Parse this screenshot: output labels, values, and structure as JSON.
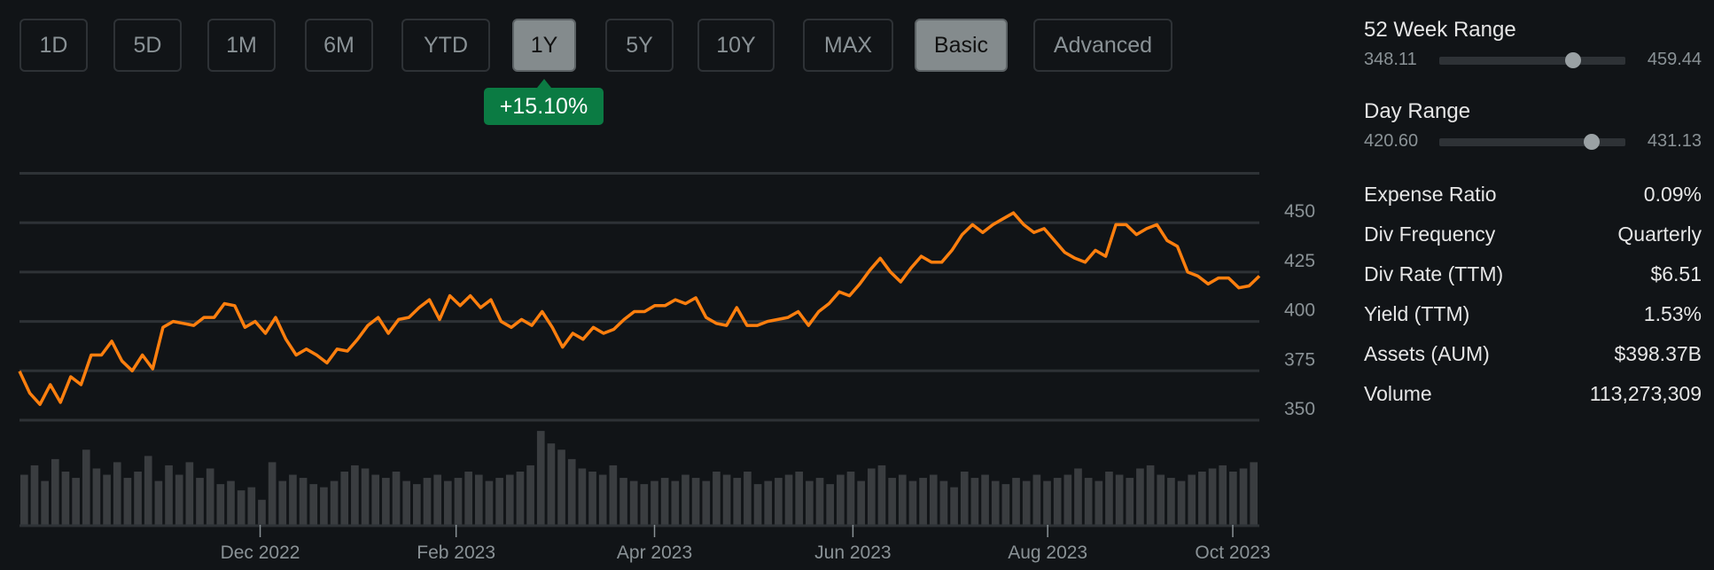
{
  "toolbar": {
    "ranges": [
      "1D",
      "5D",
      "1M",
      "6M",
      "YTD",
      "1Y",
      "5Y",
      "10Y",
      "MAX"
    ],
    "selected_range": "1Y",
    "modes": [
      "Basic",
      "Advanced"
    ],
    "selected_mode": "Basic",
    "change_badge": "+15.10%"
  },
  "colors": {
    "line": "#ff7f0e",
    "volume": "#3a3d40",
    "badge": "#0b7b43",
    "grid": "#2e3236"
  },
  "stats": {
    "week52": {
      "label": "52 Week Range",
      "low": "348.11",
      "high": "459.44",
      "position": 0.72
    },
    "day": {
      "label": "Day Range",
      "low": "420.60",
      "high": "431.13",
      "position": 0.82
    },
    "rows": [
      {
        "label": "Expense Ratio",
        "value": "0.09%"
      },
      {
        "label": "Div Frequency",
        "value": "Quarterly"
      },
      {
        "label": "Div Rate (TTM)",
        "value": "$6.51"
      },
      {
        "label": "Yield (TTM)",
        "value": "1.53%"
      },
      {
        "label": "Assets (AUM)",
        "value": "$398.37B"
      },
      {
        "label": "Volume",
        "value": "113,273,309"
      }
    ]
  },
  "chart_data": {
    "type": "line",
    "title": "",
    "ylim": [
      350,
      475
    ],
    "yticks": [
      350,
      375,
      400,
      425,
      450
    ],
    "ytick_labels": [
      "350",
      "375",
      "400",
      "425",
      "450"
    ],
    "xticks": [
      {
        "label": "Dec 2022",
        "pos": 0.196
      },
      {
        "label": "Feb 2023",
        "pos": 0.358
      },
      {
        "label": "Apr 2023",
        "pos": 0.522
      },
      {
        "label": "Jun 2023",
        "pos": 0.686
      },
      {
        "label": "Aug 2023",
        "pos": 0.847
      },
      {
        "label": "Oct 2023",
        "pos": 1.0
      }
    ],
    "price": [
      374.8,
      363.7,
      358,
      368,
      359,
      372,
      368,
      383,
      383,
      390,
      380,
      375,
      383,
      376,
      397,
      400,
      399,
      398,
      402,
      402,
      409,
      408,
      397,
      400,
      394,
      402,
      391,
      383,
      386,
      383,
      379,
      386,
      385,
      391,
      398,
      402,
      394,
      401,
      402,
      407,
      411,
      401,
      413,
      408,
      413,
      407,
      411,
      400,
      397,
      401,
      398,
      405,
      397,
      387,
      394,
      391,
      397,
      394,
      396,
      401,
      405,
      405,
      408,
      408,
      411,
      409,
      412,
      402,
      399,
      398,
      407,
      398,
      398,
      400,
      401,
      402,
      405,
      398,
      405,
      409,
      415,
      413,
      419,
      426,
      432,
      425,
      420,
      427,
      433,
      430,
      430,
      436,
      444,
      449,
      445,
      449,
      452,
      455,
      449,
      445,
      447,
      441,
      435,
      432,
      430,
      436,
      433,
      449,
      449,
      444,
      447,
      449,
      441,
      438,
      425,
      423,
      419,
      422,
      422,
      417,
      418,
      423
    ],
    "volume": [
      80,
      95,
      70,
      105,
      85,
      75,
      120,
      90,
      80,
      100,
      75,
      85,
      110,
      70,
      95,
      80,
      100,
      75,
      90,
      65,
      70,
      55,
      60,
      40,
      100,
      70,
      80,
      75,
      65,
      60,
      70,
      85,
      95,
      90,
      80,
      75,
      85,
      70,
      65,
      75,
      80,
      70,
      75,
      85,
      80,
      70,
      75,
      80,
      85,
      95,
      150,
      130,
      120,
      105,
      90,
      85,
      80,
      95,
      75,
      70,
      65,
      70,
      75,
      70,
      80,
      75,
      70,
      85,
      80,
      75,
      85,
      65,
      70,
      75,
      80,
      85,
      70,
      75,
      65,
      80,
      85,
      70,
      90,
      95,
      75,
      80,
      70,
      75,
      80,
      70,
      60,
      85,
      75,
      80,
      70,
      65,
      75,
      70,
      80,
      70,
      75,
      80,
      90,
      75,
      70,
      85,
      80,
      75,
      90,
      95,
      80,
      75,
      70,
      80,
      85,
      90,
      95,
      85,
      90,
      100
    ],
    "volume_max": 170
  }
}
